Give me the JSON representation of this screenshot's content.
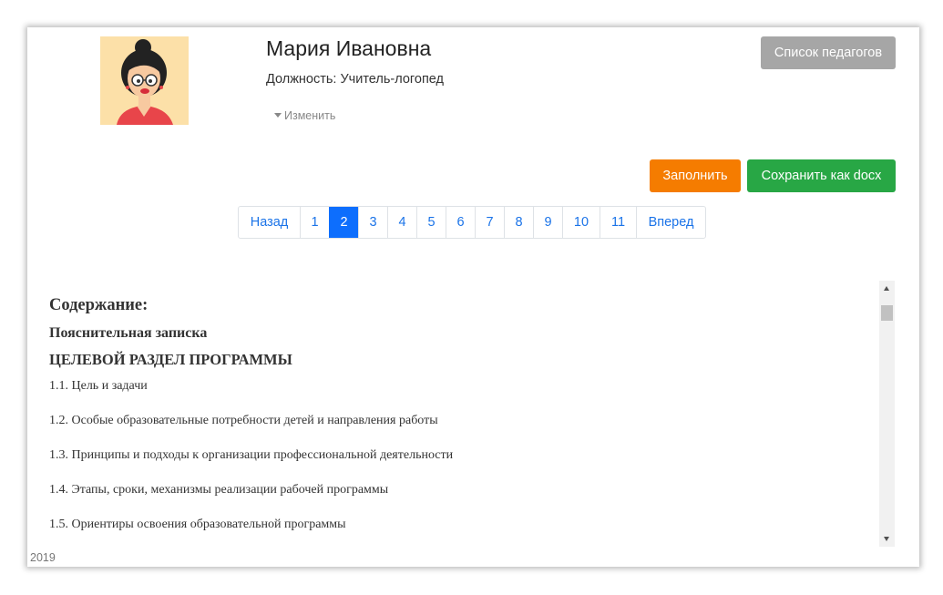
{
  "profile": {
    "name": "Мария Ивановна",
    "position": "Должность: Учитель-логопед",
    "edit_label": "Изменить"
  },
  "buttons": {
    "teachers_list": "Список педагогов",
    "fill": "Заполнить",
    "save_docx": "Сохранить как docx"
  },
  "pagination": {
    "prev": "Назад",
    "pages": [
      "1",
      "2",
      "3",
      "4",
      "5",
      "6",
      "7",
      "8",
      "9",
      "10",
      "11"
    ],
    "active": "2",
    "next": "Вперед"
  },
  "content": {
    "title": "Содержание:",
    "heading1": "Пояснительная записка",
    "heading2": "ЦЕЛЕВОЙ РАЗДЕЛ ПРОГРАММЫ",
    "items": [
      "1.1. Цель и задачи",
      "1.2. Особые образовательные потребности детей и направления работы",
      "1.3. Принципы и подходы к организации профессиональной деятельности",
      "1.4. Этапы, сроки, механизмы реализации рабочей программы",
      "1.5. Ориентиры освоения образовательной программы"
    ]
  },
  "footer": {
    "year": "2019"
  },
  "colors": {
    "fill_button": "#f57c00",
    "save_button": "#28a745",
    "teachers_button": "#a6a6a6",
    "active_page": "#0d6efd",
    "link": "#1a73e8"
  },
  "icons": {
    "avatar": "cartoon-woman-avatar",
    "edit_caret": "caret-down-icon"
  }
}
